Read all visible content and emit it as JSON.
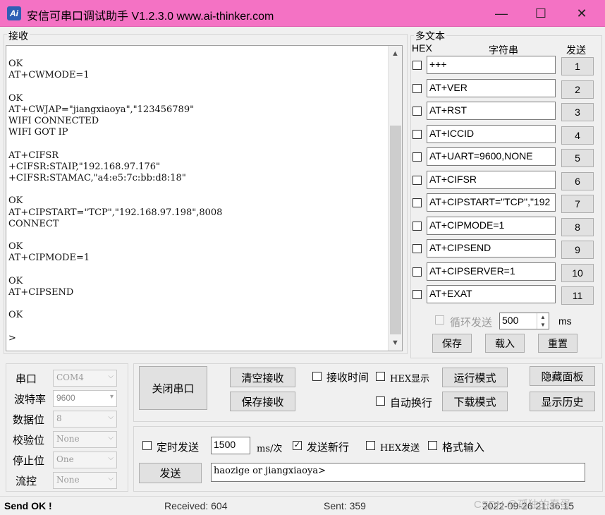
{
  "window": {
    "title": "安信可串口调试助手 V1.2.3.0    www.ai-thinker.com",
    "icon_text": "Ai",
    "minimize_glyph": "—",
    "maximize_glyph": "☐",
    "close_glyph": "✕",
    "titlebar_color": "#f472c4"
  },
  "receive": {
    "group_label": "接收",
    "text": "OK\nAT+CWMODE=1\n\nOK\nAT+CWJAP=\"jiangxiaoya\",\"123456789\"\nWIFI CONNECTED\nWIFI GOT IP\n\nAT+CIFSR\n+CIFSR:STAIP,\"192.168.97.176\"\n+CIFSR:STAMAC,\"a4:e5:7c:bb:d8:18\"\n\nOK\nAT+CIPSTART=\"TCP\",\"192.168.97.198\",8008\nCONNECT\n\nOK\nAT+CIPMODE=1\n\nOK\nAT+CIPSEND\n\nOK\n\n>",
    "scroll_up": "▲",
    "scroll_down": "▼"
  },
  "multitext": {
    "group_label": "多文本",
    "col_hex": "HEX",
    "col_string": "字符串",
    "col_send": "发送",
    "rows": [
      {
        "text": "+++",
        "button": "1"
      },
      {
        "text": "AT+VER",
        "button": "2"
      },
      {
        "text": "AT+RST",
        "button": "3"
      },
      {
        "text": "AT+ICCID",
        "button": "4"
      },
      {
        "text": "AT+UART=9600,NONE",
        "button": "5"
      },
      {
        "text": "AT+CIFSR",
        "button": "6"
      },
      {
        "text": "AT+CIPSTART=\"TCP\",\"192",
        "button": "7"
      },
      {
        "text": "AT+CIPMODE=1",
        "button": "8"
      },
      {
        "text": "AT+CIPSEND",
        "button": "9"
      },
      {
        "text": "AT+CIPSERVER=1",
        "button": "10"
      },
      {
        "text": "AT+EXAT",
        "button": "11"
      }
    ],
    "loop_send_label": "循环发送",
    "loop_interval": "500",
    "loop_unit": "ms",
    "save_button": "保存",
    "load_button": "载入",
    "reset_button": "重置"
  },
  "port_settings": {
    "port_label": "串口",
    "port_value": "COM4",
    "baud_label": "波特率",
    "baud_value": "9600",
    "databits_label": "数据位",
    "databits_value": "8",
    "parity_label": "校验位",
    "parity_value": "None",
    "stopbits_label": "停止位",
    "stopbits_value": "One",
    "flow_label": "流控",
    "flow_value": "None"
  },
  "controls": {
    "close_port_button": "关闭串口",
    "clear_receive_button": "清空接收",
    "save_receive_button": "保存接收",
    "receive_time_label": "接收时间",
    "hex_display_label": "HEX显示",
    "auto_wrap_label": "自动换行",
    "run_mode_button": "运行模式",
    "download_mode_button": "下载模式",
    "hide_panel_button": "隐藏面板",
    "show_history_button": "显示历史"
  },
  "send": {
    "timed_send_label": "定时发送",
    "timed_interval": "1500",
    "timed_unit": "ms/次",
    "send_newline_label": "发送新行",
    "send_newline_checked": true,
    "hex_send_label": "HEX发送",
    "format_input_label": "格式输入",
    "send_button": "发送",
    "send_text": "haozige or jiangxiaoya>"
  },
  "status": {
    "message": "Send OK !",
    "received": "Received: 604",
    "sent": "Sent: 359",
    "datetime": "2022-09-26 21:36:15",
    "watermark": "CSDN @孤独的春蛋"
  }
}
